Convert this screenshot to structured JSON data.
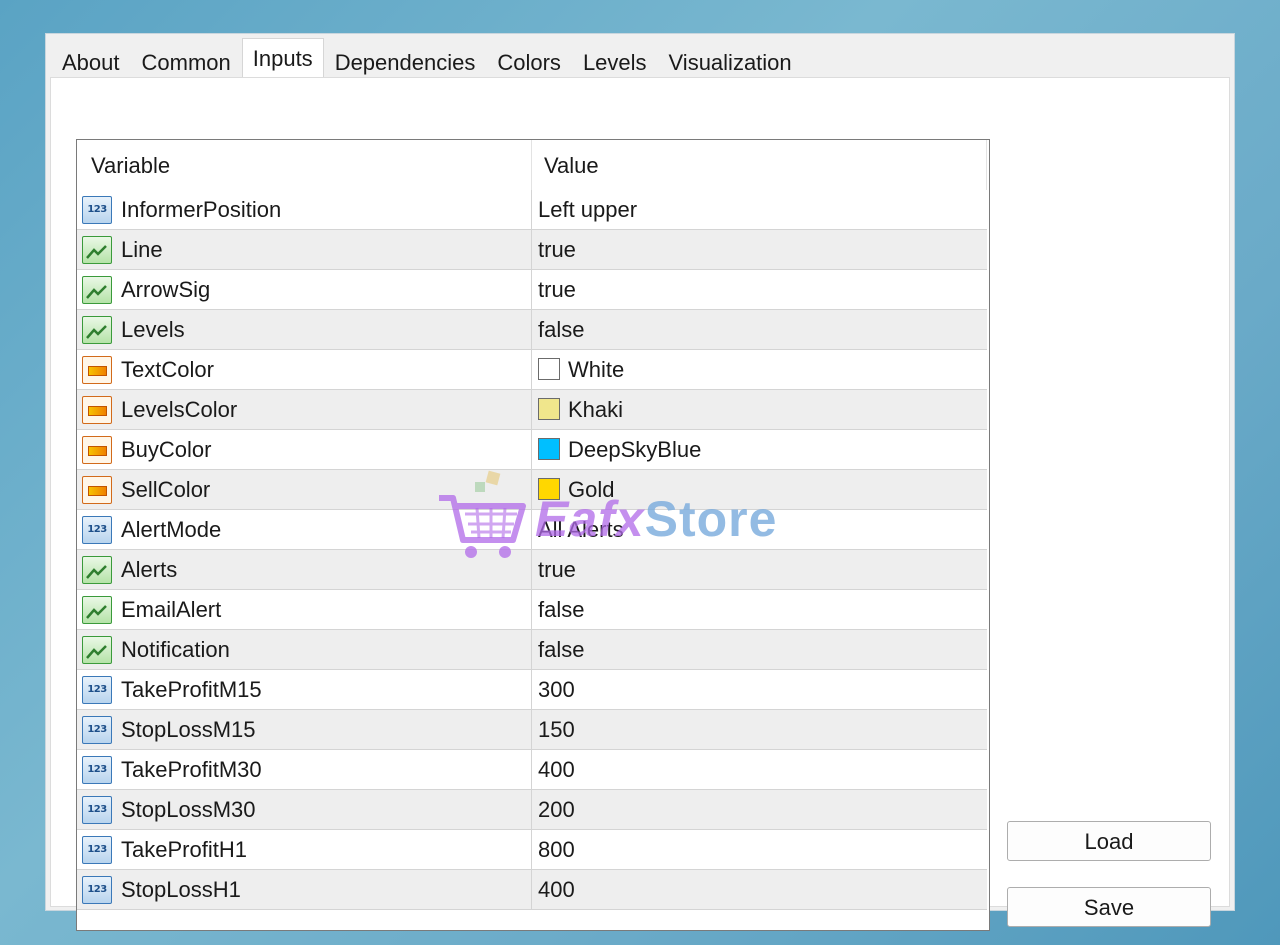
{
  "tabs": [
    {
      "label": "About"
    },
    {
      "label": "Common"
    },
    {
      "label": "Inputs"
    },
    {
      "label": "Dependencies"
    },
    {
      "label": "Colors"
    },
    {
      "label": "Levels"
    },
    {
      "label": "Visualization"
    }
  ],
  "active_tab": "Inputs",
  "grid": {
    "header": {
      "variable": "Variable",
      "value": "Value"
    },
    "rows": [
      {
        "name": "InformerPosition",
        "value": "Left upper",
        "type": "number-icon"
      },
      {
        "name": "Line",
        "value": "true",
        "type": "boolean-icon"
      },
      {
        "name": "ArrowSig",
        "value": "true",
        "type": "boolean-icon"
      },
      {
        "name": "Levels",
        "value": "false",
        "type": "boolean-icon"
      },
      {
        "name": "TextColor",
        "value": "White",
        "type": "color-icon",
        "swatch": "#ffffff"
      },
      {
        "name": "LevelsColor",
        "value": "Khaki",
        "type": "color-icon",
        "swatch": "#f0e68c"
      },
      {
        "name": "BuyColor",
        "value": "DeepSkyBlue",
        "type": "color-icon",
        "swatch": "#00bfff"
      },
      {
        "name": "SellColor",
        "value": "Gold",
        "type": "color-icon",
        "swatch": "#ffd700"
      },
      {
        "name": "AlertMode",
        "value": "All Alerts",
        "type": "number-icon"
      },
      {
        "name": "Alerts",
        "value": "true",
        "type": "boolean-icon"
      },
      {
        "name": "EmailAlert",
        "value": "false",
        "type": "boolean-icon"
      },
      {
        "name": "Notification",
        "value": "false",
        "type": "boolean-icon"
      },
      {
        "name": "TakeProfitM15",
        "value": "300",
        "type": "number-icon"
      },
      {
        "name": "StopLossM15",
        "value": "150",
        "type": "number-icon"
      },
      {
        "name": "TakeProfitM30",
        "value": "400",
        "type": "number-icon"
      },
      {
        "name": "StopLossM30",
        "value": "200",
        "type": "number-icon"
      },
      {
        "name": "TakeProfitH1",
        "value": "800",
        "type": "number-icon"
      },
      {
        "name": "StopLossH1",
        "value": "400",
        "type": "number-icon"
      }
    ]
  },
  "buttons": {
    "load": "Load",
    "save": "Save"
  },
  "icons": {
    "number_glyph": "123"
  },
  "watermark": {
    "part1": "Eafx",
    "part2": "Store"
  }
}
